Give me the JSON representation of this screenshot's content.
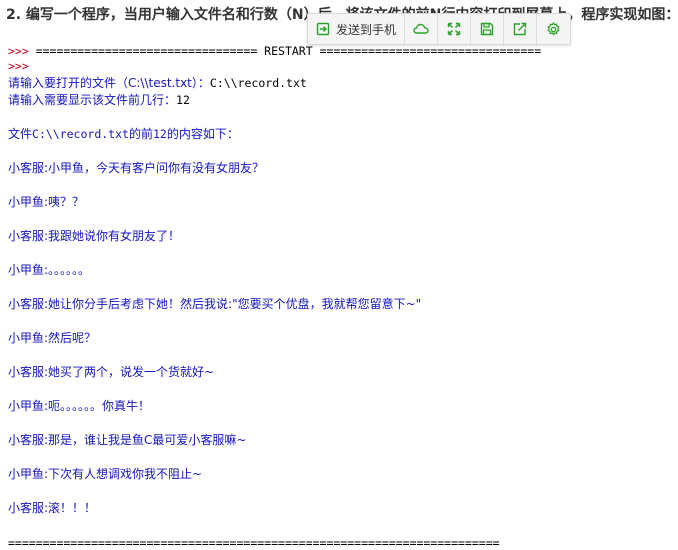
{
  "question": "2. 编写一个程序，当用户输入文件名和行数（N）后，将该文件的前N行内容打印到屏幕上，程序实现如图：",
  "toolbar": {
    "send_label": "发送到手机",
    "icons": [
      "send-to-phone-icon",
      "cloud-icon",
      "expand-icon",
      "save-icon",
      "share-icon",
      "settings-icon"
    ],
    "accent_color": "#2aa12a"
  },
  "console": {
    "restart_line": "================================ RESTART ================================",
    "prompt1": ">>> ",
    "prompt2": ">>>",
    "input_file_prompt": "请输入要打开的文件（C:\\\\test.txt）：",
    "input_file_value": "C:\\\\record.txt",
    "input_lines_prompt": "请输入需要显示该文件前几行：",
    "input_lines_value": "12",
    "header_prefix": "文件",
    "header_file": "C:\\\\record.txt",
    "header_mid": "的前",
    "header_num": "12",
    "header_suffix": "的内容如下：",
    "dialog": [
      "小客服:小甲鱼，今天有客户问你有没有女朋友？",
      "小甲鱼:咦？？",
      "小客服:我跟她说你有女朋友了！",
      "小甲鱼:。。。。。。",
      "小客服:她让你分手后考虑下她！然后我说:\"您要买个优盘，我就帮您留意下~\"",
      "小甲鱼:然后呢？",
      "小客服:她买了两个，说发一个货就好~",
      "小甲鱼:呃。。。。。。你真牛！",
      "小客服:那是，谁让我是鱼C最可爱小客服嘛~",
      "小甲鱼:下次有人想调戏你我不阻止~",
      "小客服:滚！！！"
    ],
    "bottom_line": "======================================================================="
  }
}
